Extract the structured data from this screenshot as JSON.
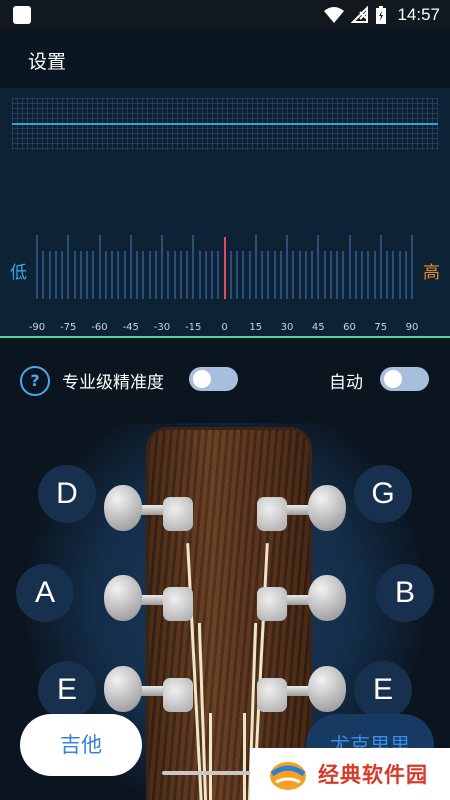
{
  "status_bar": {
    "time": "14:57"
  },
  "header": {
    "settings_label": "设置"
  },
  "tuner": {
    "low_label": "低",
    "high_label": "高",
    "scale": [
      "-90",
      "-75",
      "-60",
      "-45",
      "-30",
      "-15",
      "0",
      "15",
      "30",
      "45",
      "60",
      "75",
      "90"
    ]
  },
  "options": {
    "pro_precision_label": "专业级精准度",
    "auto_label": "自动",
    "help_symbol": "?"
  },
  "strings": {
    "left_top": "D",
    "left_mid": "A",
    "left_bottom": "E",
    "right_top": "G",
    "right_mid": "B",
    "right_bottom": "E"
  },
  "instruments": {
    "guitar": "吉他",
    "ukulele": "尤克里里"
  },
  "watermark": {
    "text": "经典软件园"
  },
  "colors": {
    "accent_blue": "#37a8e4",
    "high_orange": "#e58c2a",
    "center_red": "#e34b5c",
    "baseline_green": "#4bd69a"
  }
}
